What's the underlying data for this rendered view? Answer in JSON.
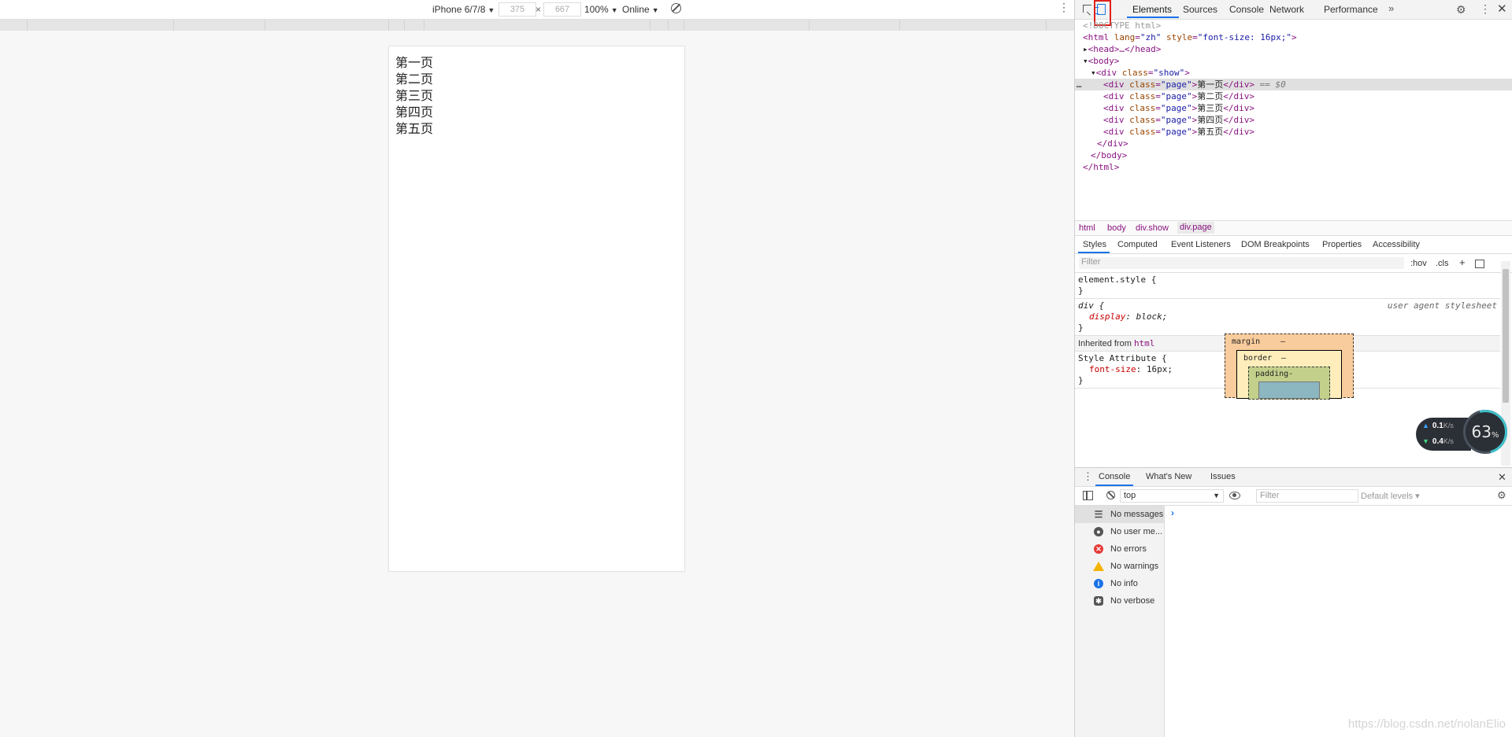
{
  "device_toolbar": {
    "device": "iPhone 6/7/8",
    "width": "375",
    "height": "667",
    "times": "×",
    "zoom": "100%",
    "throttle": "Online"
  },
  "page": {
    "lines": [
      "第一页",
      "第二页",
      "第三页",
      "第四页",
      "第五页"
    ]
  },
  "devtools": {
    "tabs": [
      "Elements",
      "Sources",
      "Console",
      "Network",
      "Performance"
    ],
    "more": "»",
    "dom": {
      "doctype": "<!DOCTYPE html>",
      "html_open_tag": "<html",
      "lang_attr": "lang",
      "lang_val": "\"zh\"",
      "style_attr": "style",
      "style_val": "\"font-size: 16px;\"",
      "gt": ">",
      "head": "<head>…</head>",
      "body_open": "<body>",
      "div_open_tag": "<div",
      "class_attr": "class",
      "show_val": "\"show\"",
      "page_val": "\"page\"",
      "div_close": "</div>",
      "page_texts": [
        "第一页",
        "第二页",
        "第三页",
        "第四页",
        "第五页"
      ],
      "selected_marker": "== $0",
      "ellipsis": "…",
      "body_close": "</body>",
      "html_close": "</html>"
    },
    "breadcrumbs": [
      "html",
      "body",
      "div.show",
      "div.page"
    ],
    "style_tabs": [
      "Styles",
      "Computed",
      "Event Listeners",
      "DOM Breakpoints",
      "Properties",
      "Accessibility"
    ],
    "filter_placeholder": "Filter",
    "hov": ":hov",
    "cls": ".cls",
    "plus": "+",
    "rules": {
      "element_style": "element.style {",
      "close_brace": "}",
      "div_selector": "div {",
      "ua_label": "user agent stylesheet",
      "display_name": "display",
      "display_value": ": block;",
      "inherited_prefix": "Inherited from",
      "inherited_tag": "html",
      "style_attr_selector": "Style Attribute {",
      "font_size_name": "font-size",
      "font_size_value": ": 16px;"
    },
    "box_model": {
      "margin": "margin",
      "border": "border",
      "padding": "padding-",
      "dash": "–"
    },
    "net_monitor": {
      "up": "0.1",
      "down": "0.4",
      "unit": "K/s",
      "percent": "63",
      "percent_sign": "%"
    },
    "drawer_tabs": [
      "Console",
      "What's New",
      "Issues"
    ],
    "console": {
      "context": "top",
      "filter_placeholder": "Filter",
      "levels": "Default levels ▾",
      "prompt": "›",
      "sidebar": [
        "No messages",
        "No user me...",
        "No errors",
        "No warnings",
        "No info",
        "No verbose"
      ]
    }
  },
  "watermark": "https://blog.csdn.net/nolanElio"
}
